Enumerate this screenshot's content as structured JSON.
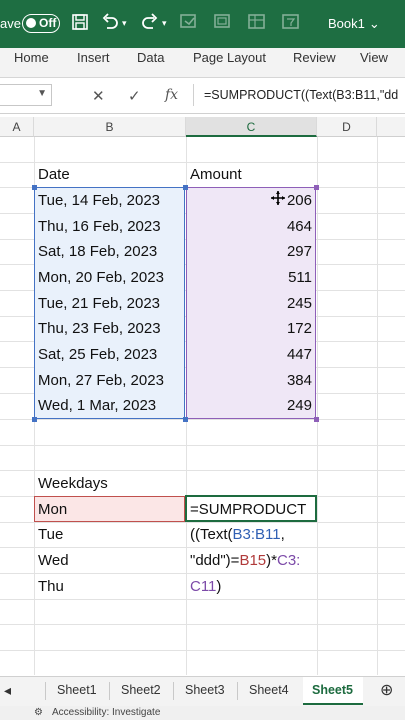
{
  "titlebar": {
    "autosave_label": "ave",
    "toggle_label": "Off",
    "book_name": "Book1"
  },
  "ribbon": {
    "tabs": [
      "Home",
      "Insert",
      "Data",
      "Page Layout",
      "Review",
      "View"
    ]
  },
  "formula_bar": {
    "fx_label": "fx",
    "formula": "=SUMPRODUCT((Text(B3:B11,\"dd"
  },
  "columns": [
    "A",
    "B",
    "C",
    "D"
  ],
  "headers": {
    "date": "Date",
    "amount": "Amount"
  },
  "rows": [
    {
      "date": "Tue, 14 Feb, 2023",
      "amount": "206"
    },
    {
      "date": "Thu, 16 Feb, 2023",
      "amount": "464"
    },
    {
      "date": "Sat, 18 Feb, 2023",
      "amount": "297"
    },
    {
      "date": "Mon, 20 Feb, 2023",
      "amount": "511"
    },
    {
      "date": "Tue, 21 Feb, 2023",
      "amount": "245"
    },
    {
      "date": "Thu, 23 Feb, 2023",
      "amount": "172"
    },
    {
      "date": "Sat, 25 Feb, 2023",
      "amount": "447"
    },
    {
      "date": "Mon, 27 Feb, 2023",
      "amount": "384"
    },
    {
      "date": "Wed, 1 Mar, 2023",
      "amount": "249"
    }
  ],
  "weekdays": {
    "header": "Weekdays",
    "items": [
      "Mon",
      "Tue",
      "Wed",
      "Thu"
    ]
  },
  "edit_formula": {
    "line1": "=SUMPRODUCT",
    "line2a": "((Text(",
    "line2b": "B3:B11",
    "line2c": ",",
    "line3a": "\"ddd\")=",
    "line3b": "B15",
    "line3c": ")*",
    "line3d": "C3:",
    "line4a": "C11",
    "line4b": ")"
  },
  "sheets": [
    "Sheet1",
    "Sheet2",
    "Sheet3",
    "Sheet4",
    "Sheet5"
  ],
  "status": {
    "accessibility": "Accessibility: Investigate"
  },
  "colors": {
    "excel_green": "#1e6e42",
    "range_blue": "#4472c4",
    "range_purple": "#8e5fb8",
    "range_red": "#c0504d"
  }
}
